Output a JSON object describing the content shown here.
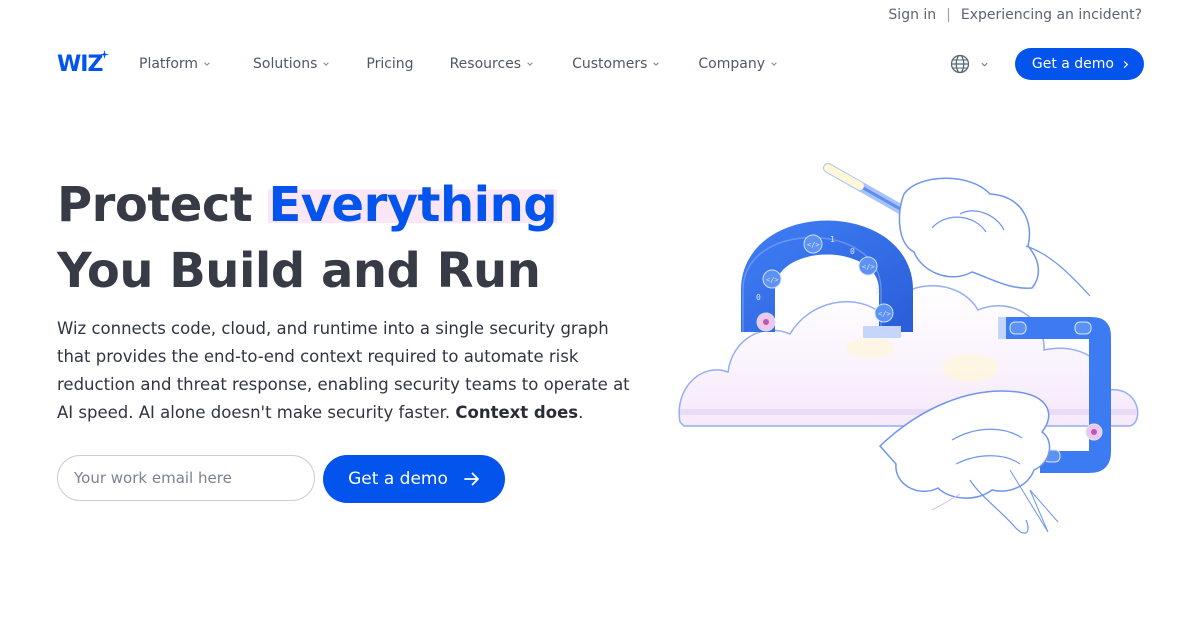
{
  "utility": {
    "sign_in": "Sign in",
    "separator": "|",
    "incident": "Experiencing an incident?"
  },
  "brand": {
    "logo_text": "WIZ",
    "accent": "#0254ec"
  },
  "nav": {
    "items": [
      {
        "label": "Platform",
        "has_dropdown": true
      },
      {
        "label": "Solutions",
        "has_dropdown": true
      },
      {
        "label": "Pricing",
        "has_dropdown": false
      },
      {
        "label": "Resources",
        "has_dropdown": true
      },
      {
        "label": "Customers",
        "has_dropdown": true
      },
      {
        "label": "Company",
        "has_dropdown": true
      }
    ],
    "language_icon": "globe-icon",
    "cta_label": "Get a demo"
  },
  "hero": {
    "title_start": "Protect ",
    "title_highlight": "Everything",
    "title_line2": "You Build and Run",
    "description": "Wiz connects code, cloud, and runtime into a single security graph that provides the end-to-end context required to automate risk reduction and threat response, enabling security teams to operate at AI speed. AI alone doesn't make security faster. ",
    "description_bold": "Context does",
    "description_end": ".",
    "email_placeholder": "Your work email here",
    "cta_label": "Get a demo"
  },
  "illustration": {
    "magnet_glyph": "</>",
    "digits": [
      "1",
      "0"
    ]
  }
}
